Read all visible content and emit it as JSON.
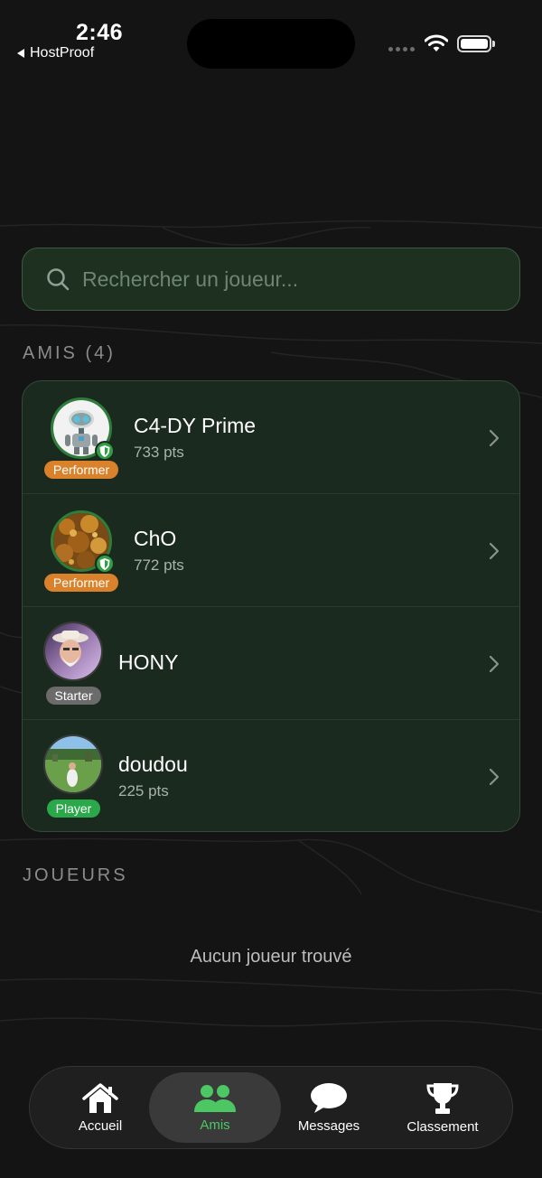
{
  "status_bar": {
    "time": "2:46",
    "back_app": "HostProof"
  },
  "search": {
    "placeholder": "Rechercher un joueur...",
    "value": ""
  },
  "friends_section": {
    "title": "AMIS (4)",
    "friends": [
      {
        "name": "C4-DY Prime",
        "points": "733 pts",
        "tier": "Performer",
        "verified": true
      },
      {
        "name": "ChO",
        "points": "772 pts",
        "tier": "Performer",
        "verified": true
      },
      {
        "name": "HONY",
        "points": "",
        "tier": "Starter",
        "verified": false
      },
      {
        "name": "doudou",
        "points": "225 pts",
        "tier": "Player",
        "verified": false
      }
    ]
  },
  "players_section": {
    "title": "JOUEURS",
    "empty_message": "Aucun joueur trouvé"
  },
  "tab_bar": {
    "tabs": [
      {
        "label": "Accueil",
        "icon": "home-icon",
        "active": false
      },
      {
        "label": "Amis",
        "icon": "friends-icon",
        "active": true
      },
      {
        "label": "Messages",
        "icon": "chat-bubble-icon",
        "active": false
      },
      {
        "label": "Classement",
        "icon": "trophy-icon",
        "active": false
      }
    ]
  },
  "colors": {
    "background": "#141414",
    "card": "#1b2a1f",
    "accent_green": "#4cc764",
    "performer": "#d9822b",
    "starter": "#6b6b6b",
    "player": "#2aa84a"
  }
}
